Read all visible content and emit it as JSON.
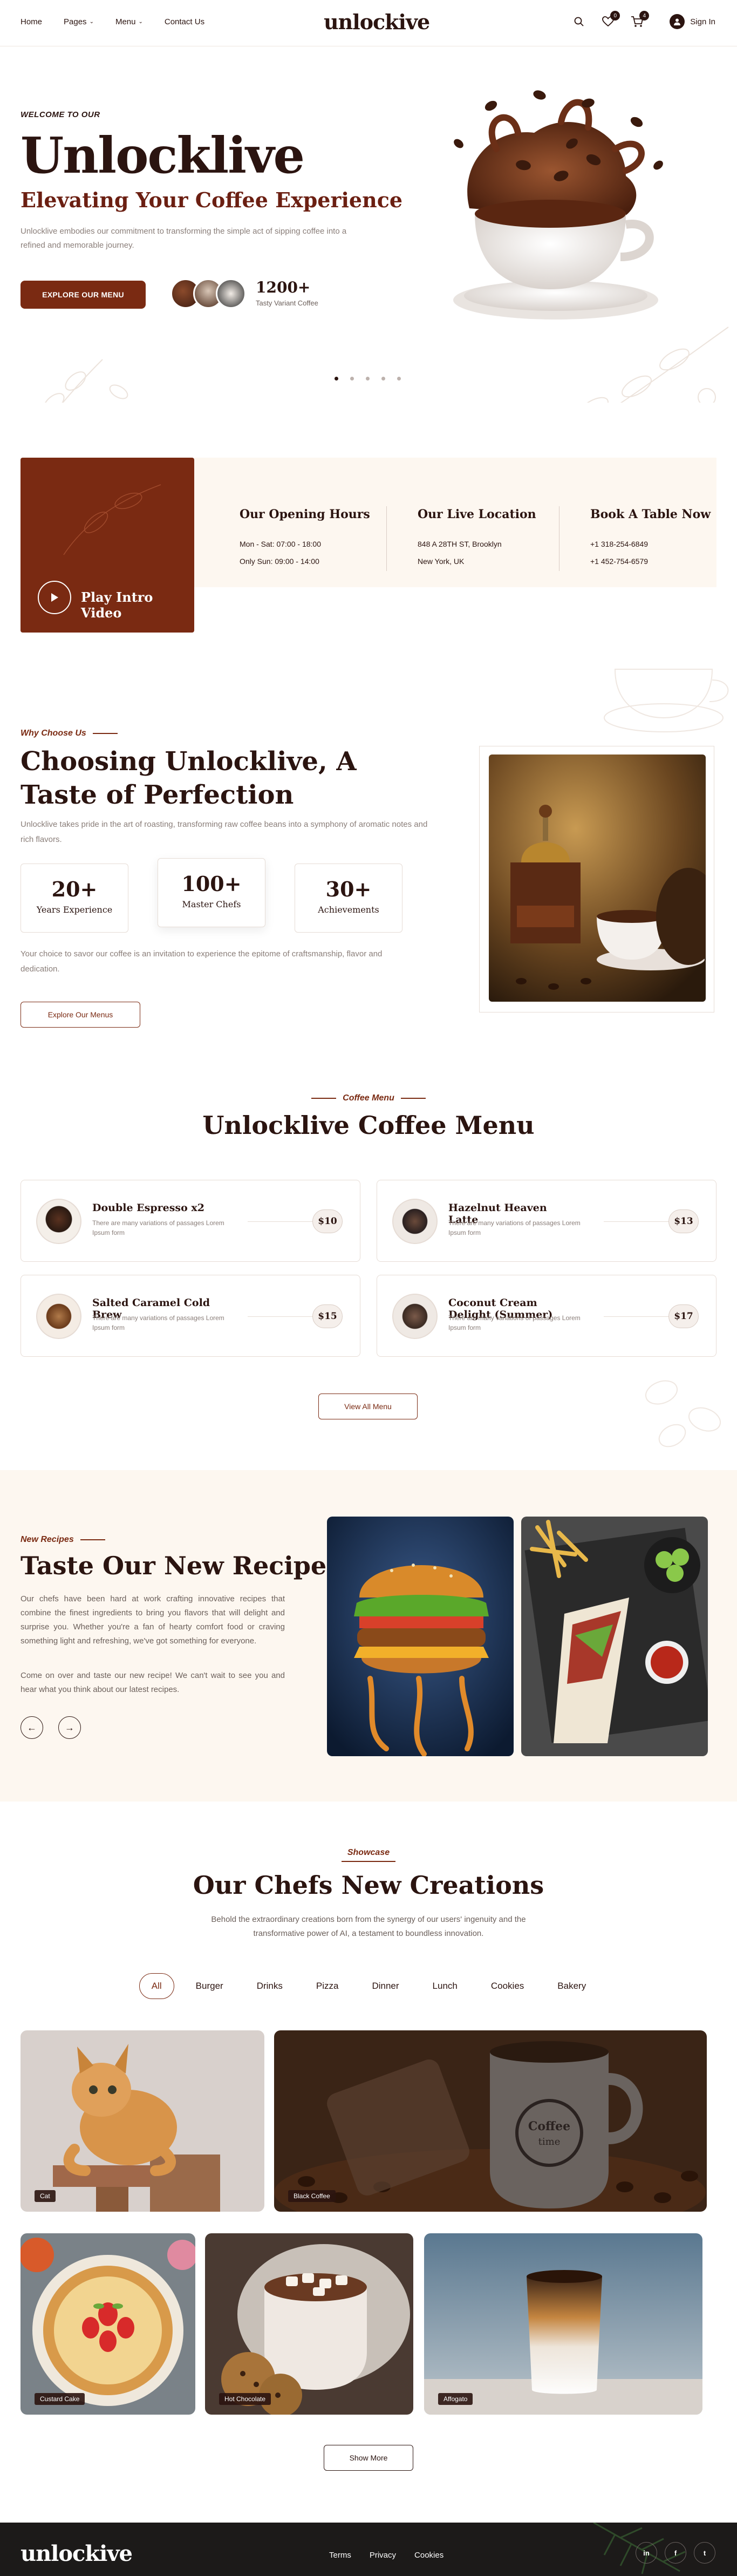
{
  "header": {
    "nav": [
      {
        "label": "Home",
        "dropdown": false
      },
      {
        "label": "Pages",
        "dropdown": true
      },
      {
        "label": "Menu",
        "dropdown": true
      },
      {
        "label": "Contact Us",
        "dropdown": false
      }
    ],
    "logo": "unlockive",
    "wishlist_count": "0",
    "cart_count": "4",
    "signin_label": "Sign In"
  },
  "hero": {
    "welcome": "WELCOME TO OUR",
    "title": "Unlocklive",
    "subtitle": "Elevating Your Coffee Experience",
    "description": "Unlocklive embodies our commitment to transforming the simple act of sipping coffee into a refined and memorable journey.",
    "button": "EXPLORE OUR MENU",
    "count": "1200+",
    "count_label": "Tasty Variant Coffee",
    "slides": 5,
    "active_slide": 1
  },
  "info": {
    "video_label": "Play Intro Video",
    "columns": [
      {
        "title": "Our Opening Hours",
        "lines": [
          "Mon - Sat: 07:00 - 18:00",
          "Only Sun: 09:00 - 14:00"
        ]
      },
      {
        "title": "Our Live Location",
        "lines": [
          "848 A 28TH ST, Brooklyn",
          "New York, UK"
        ]
      },
      {
        "title": "Book A Table Now",
        "lines": [
          "+1 318-254-6849",
          "+1 452-754-6579"
        ]
      }
    ]
  },
  "why": {
    "tag": "Why Choose Us",
    "title": "Choosing Unlocklive, A Taste of Perfection",
    "description": "Unlocklive takes pride in the art of roasting, transforming raw coffee beans into a symphony of aromatic notes and rich flavors.",
    "stats": [
      {
        "value": "20+",
        "label": "Years Experience"
      },
      {
        "value": "100+",
        "label": "Master Chefs"
      },
      {
        "value": "30+",
        "label": "Achievements"
      }
    ],
    "description2": "Your choice to savor our coffee is an invitation to experience the epitome of craftsmanship, flavor and dedication.",
    "button": "Explore Our Menus"
  },
  "menu": {
    "tag": "Coffee Menu",
    "title": "Unlocklive Coffee Menu",
    "items": [
      {
        "name": "Double Espresso x2",
        "desc": "There are many variations of passages Lorem Ipsum form",
        "price": "$10"
      },
      {
        "name": "Hazelnut Heaven Latte",
        "desc": "There are many variations of passages Lorem Ipsum form",
        "price": "$13"
      },
      {
        "name": "Salted Caramel Cold Brew",
        "desc": "There are many variations of passages Lorem Ipsum form",
        "price": "$15"
      },
      {
        "name": "Coconut Cream Delight (Summer)",
        "desc": "There are many variations of passages Lorem Ipsum form",
        "price": "$17"
      }
    ],
    "button": "View All Menu"
  },
  "recipe": {
    "tag": "New Recipes",
    "title": "Taste Our New Recipe",
    "p1": "Our chefs have been hard at work crafting innovative recipes that combine the finest ingredients to bring you flavors that will delight and surprise you. Whether you're a fan of hearty comfort food or craving something light and refreshing, we've got something for everyone.",
    "p2": "Come on over and taste our new recipe! We can't wait to see you and hear what you think about our latest recipes.",
    "prev": "←",
    "next": "→"
  },
  "showcase": {
    "tag": "Showcase",
    "title": "Our Chefs New Creations",
    "description": "Behold the extraordinary creations born from the synergy of our users' ingenuity and the transformative power of AI, a testament to boundless innovation.",
    "filters": [
      "All",
      "Burger",
      "Drinks",
      "Pizza",
      "Dinner",
      "Lunch",
      "Cookies",
      "Bakery"
    ],
    "active_filter": "All",
    "gallery": [
      {
        "label": "Cat"
      },
      {
        "label": "Black Coffee"
      },
      {
        "label": "Custard Cake"
      },
      {
        "label": "Hot Chocolate"
      },
      {
        "label": "Affogato"
      }
    ],
    "button": "Show More"
  },
  "footer": {
    "logo": "unlockive",
    "links": [
      "Terms",
      "Privacy",
      "Cookies"
    ],
    "socials": [
      "in",
      "f",
      "t"
    ]
  },
  "colors": {
    "brand": "#7a2a12",
    "dark": "#2b1410",
    "cream": "#fdf7f0",
    "footer": "#1c1a19"
  }
}
